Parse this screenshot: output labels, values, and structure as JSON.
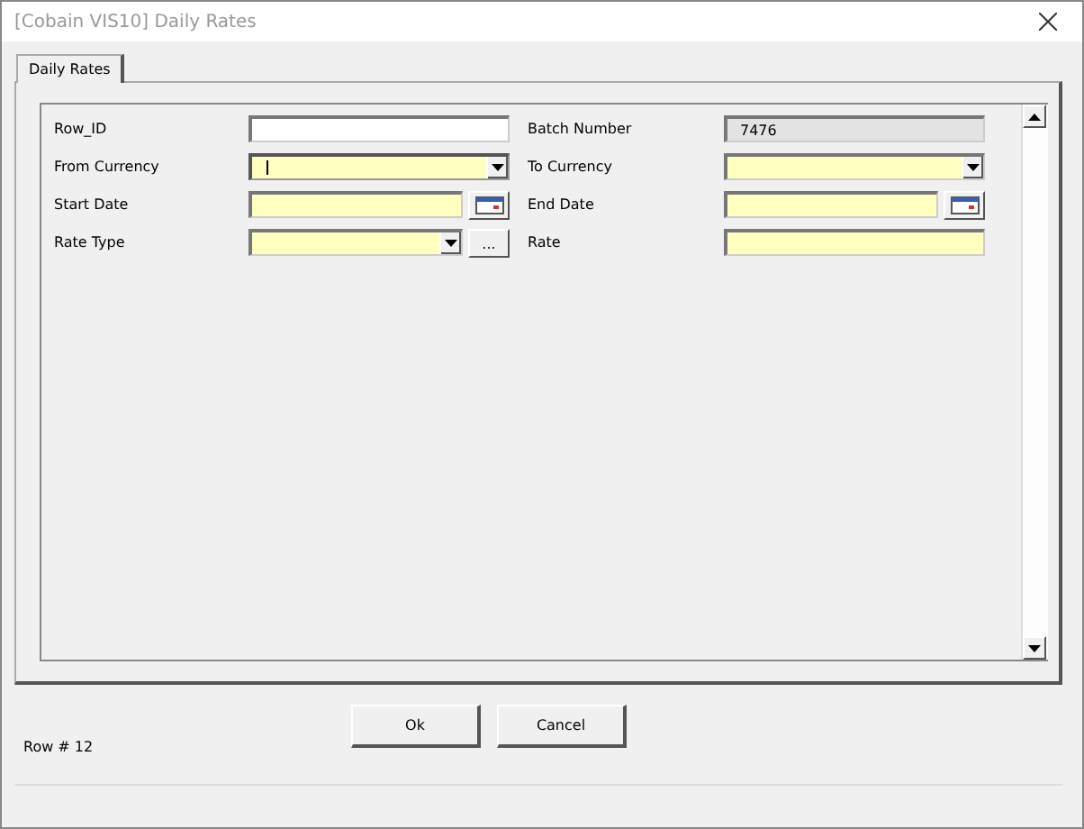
{
  "window": {
    "title": "[Cobain VIS10] Daily Rates"
  },
  "tabs": [
    {
      "label": "Daily Rates",
      "selected": true
    }
  ],
  "rows": [
    [
      {
        "label": "Row_ID",
        "kind": "text",
        "required": false,
        "readonly": false,
        "focused": false
      },
      {
        "label": "Batch Number",
        "kind": "text",
        "readonly": true,
        "value": "7476",
        "focused": false
      }
    ],
    [
      {
        "label": "From Currency",
        "kind": "dropdown",
        "required": true,
        "readonly": false,
        "focused": true
      },
      {
        "label": "To Currency",
        "kind": "dropdown",
        "required": true,
        "readonly": false,
        "focused": false
      }
    ],
    [
      {
        "label": "Start Date",
        "kind": "date",
        "required": true,
        "readonly": false,
        "focused": false
      },
      {
        "label": "End Date",
        "kind": "date",
        "required": true,
        "readonly": false,
        "focused": false
      }
    ],
    [
      {
        "label": "Rate Type",
        "kind": "lookup",
        "required": true,
        "readonly": false,
        "button": "...",
        "focused": false
      },
      {
        "label": "Rate",
        "kind": "text",
        "required": true,
        "readonly": false,
        "focused": false
      }
    ]
  ],
  "row_indicator": "Row # 12",
  "buttons": [
    "Ok",
    "Cancel"
  ]
}
